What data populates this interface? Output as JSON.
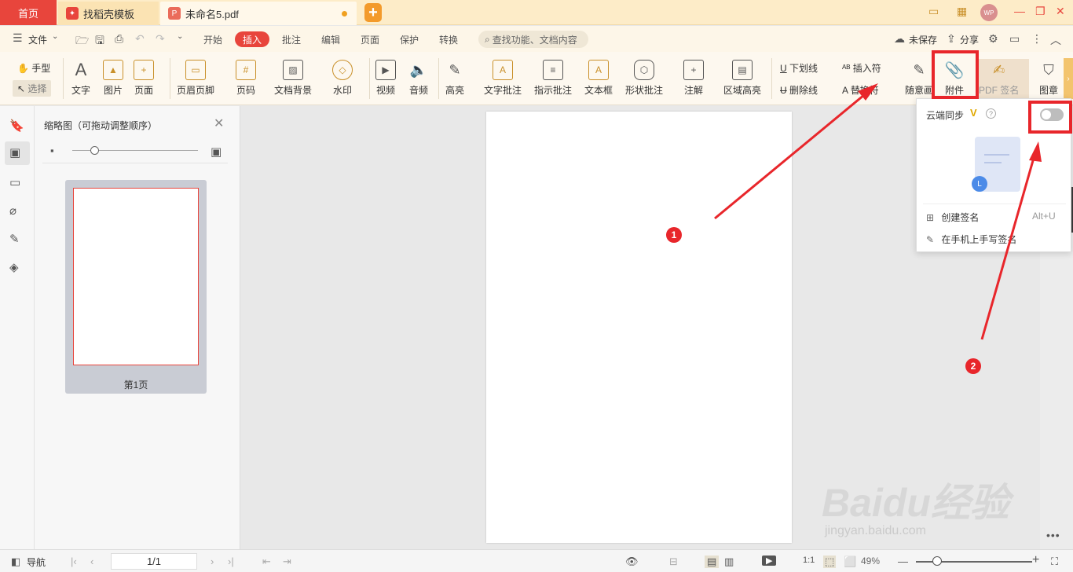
{
  "titlebar": {
    "home_tab": "首页",
    "tabs": [
      "找稻壳模板",
      "未命名5.pdf"
    ],
    "avatar": "WP"
  },
  "menu": {
    "file": "文件",
    "items": [
      "开始",
      "插入",
      "批注",
      "编辑",
      "页面",
      "保护",
      "转换"
    ],
    "active": "插入",
    "search_placeholder": "查找功能、文档内容",
    "unsaved": "未保存",
    "share": "分享"
  },
  "ribbon": {
    "hand": "手型",
    "select": "选择",
    "text": "文字",
    "image": "图片",
    "page": "页面",
    "header_footer": "页眉页脚",
    "page_number": "页码",
    "background": "文档背景",
    "watermark": "水印",
    "video": "视频",
    "audio": "音频",
    "highlight": "高亮",
    "text_comment": "文字批注",
    "pointer_comment": "指示批注",
    "textbox": "文本框",
    "shape_comment": "形状批注",
    "note": "注解",
    "area_highlight": "区域高亮",
    "underline": "下划线",
    "strikethrough": "删除线",
    "insert_mark": "插入符",
    "replace_mark": "替换符",
    "freehand": "随意画",
    "attachment": "附件",
    "pdf_sign": "PDF 签名",
    "stamp": "图章"
  },
  "thumbnail_panel": {
    "title": "缩略图（可拖动调整顺序）",
    "page_label": "第1页",
    "zoom_level": 0.18
  },
  "sign_popup": {
    "cloud_sync": "云端同步",
    "vip": "V",
    "help": "?",
    "cloud_sync_enabled": false,
    "create_sign": "创建签名",
    "create_shortcut": "Alt+U",
    "phone_sign": "在手机上手写签名"
  },
  "annotations": {
    "badge_1": "1",
    "badge_2": "2"
  },
  "statusbar": {
    "nav": "导航",
    "page_indicator": "1/1",
    "zoom": "49%",
    "zoom_level": 0.18
  },
  "watermark": {
    "text": "Baidu经验",
    "url": "jingyan.baidu.com"
  },
  "colors": {
    "accent": "#e8453c",
    "annotation_red": "#e8262b",
    "titlebar_bg": "#fdecc8"
  }
}
